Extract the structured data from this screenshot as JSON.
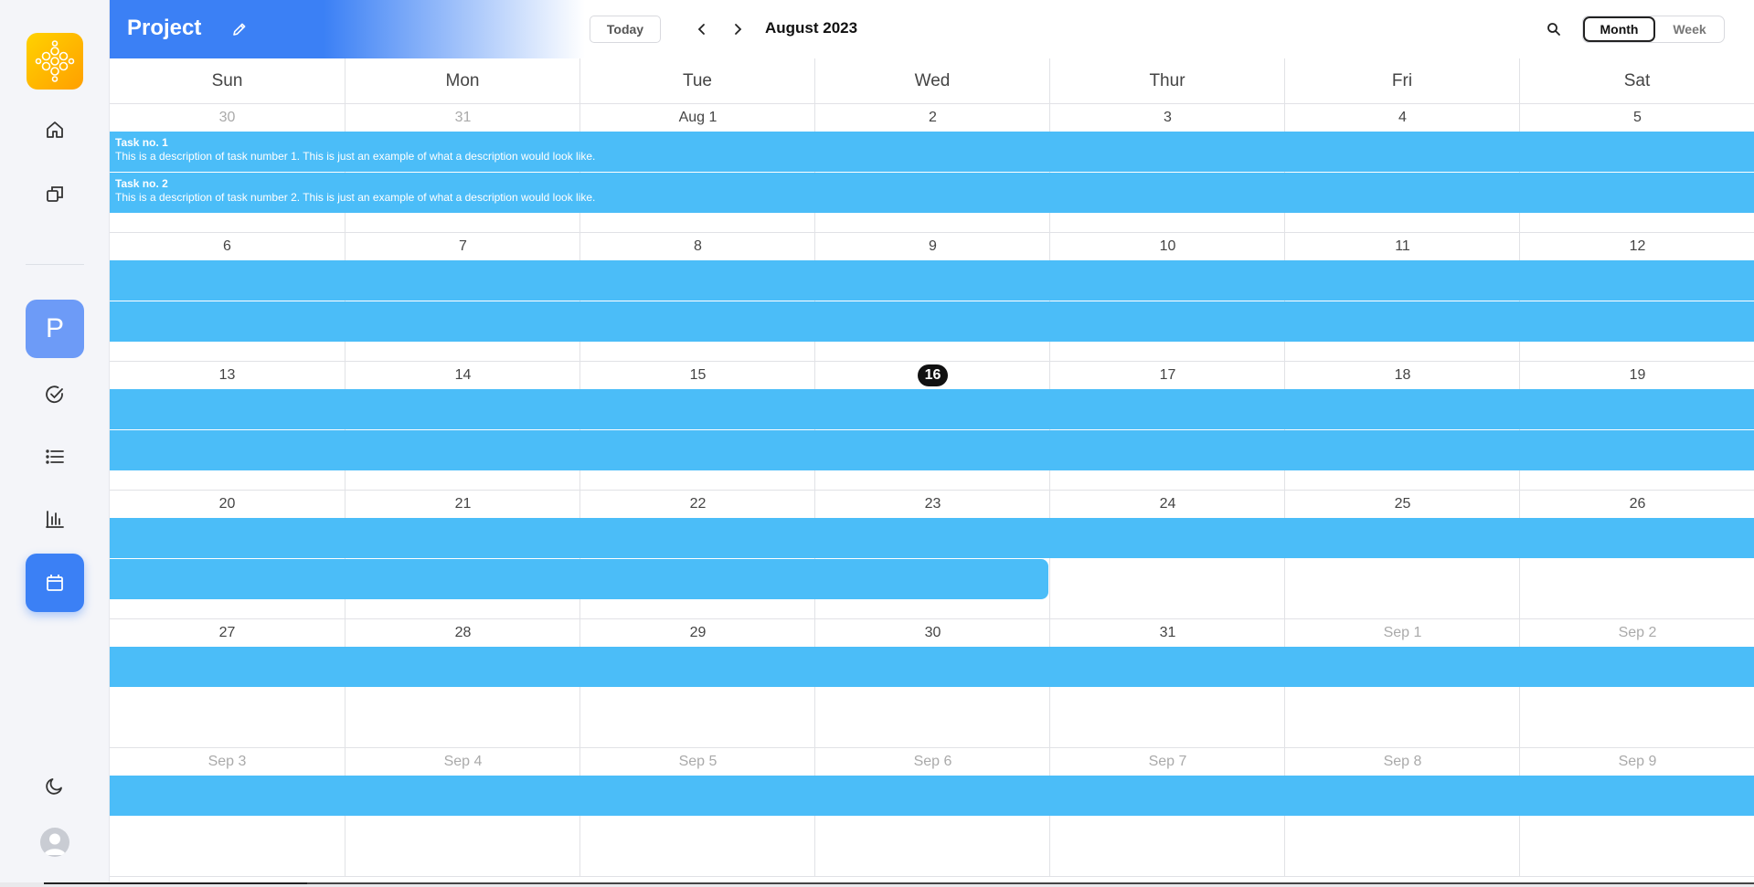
{
  "app": {
    "project_title": "Project",
    "project_initial": "P",
    "colors": {
      "accent": "#3b80f5",
      "event": "#4bbdf8",
      "today": "#111111"
    }
  },
  "sidebar": {
    "icons": [
      "home-icon",
      "copy-icon",
      "check-circle-icon",
      "list-icon",
      "bar-chart-icon",
      "calendar-icon",
      "moon-icon",
      "avatar"
    ]
  },
  "header": {
    "today_label": "Today",
    "month_label": "August 2023",
    "views": [
      {
        "label": "Month",
        "active": true
      },
      {
        "label": "Week",
        "active": false
      }
    ]
  },
  "calendar": {
    "days_of_week": [
      "Sun",
      "Mon",
      "Tue",
      "Wed",
      "Thur",
      "Fri",
      "Sat"
    ],
    "weeks": [
      [
        "30",
        "31",
        "Aug 1",
        "2",
        "3",
        "4",
        "5"
      ],
      [
        "6",
        "7",
        "8",
        "9",
        "10",
        "11",
        "12"
      ],
      [
        "13",
        "14",
        "15",
        "16",
        "17",
        "18",
        "19"
      ],
      [
        "20",
        "21",
        "22",
        "23",
        "24",
        "25",
        "26"
      ],
      [
        "27",
        "28",
        "29",
        "30",
        "31",
        "Sep 1",
        "Sep 2"
      ],
      [
        "Sep 3",
        "Sep 4",
        "Sep 5",
        "Sep 6",
        "Sep 7",
        "Sep 8",
        "Sep 9"
      ]
    ],
    "other_month": [
      [
        true,
        true,
        false,
        false,
        false,
        false,
        false
      ],
      [
        false,
        false,
        false,
        false,
        false,
        false,
        false
      ],
      [
        false,
        false,
        false,
        false,
        false,
        false,
        false
      ],
      [
        false,
        false,
        false,
        false,
        false,
        false,
        false
      ],
      [
        false,
        false,
        false,
        false,
        false,
        true,
        true
      ],
      [
        true,
        true,
        true,
        true,
        true,
        true,
        true
      ]
    ],
    "today": {
      "week": 2,
      "day": 3
    },
    "tasks": [
      {
        "title": "Task no. 1",
        "description": "This is a description of task number 1. This is just an example of what a description would look like."
      },
      {
        "title": "Task no. 2",
        "description": "This is a description of task number 2. This is just an example of what a description would look like."
      }
    ]
  }
}
